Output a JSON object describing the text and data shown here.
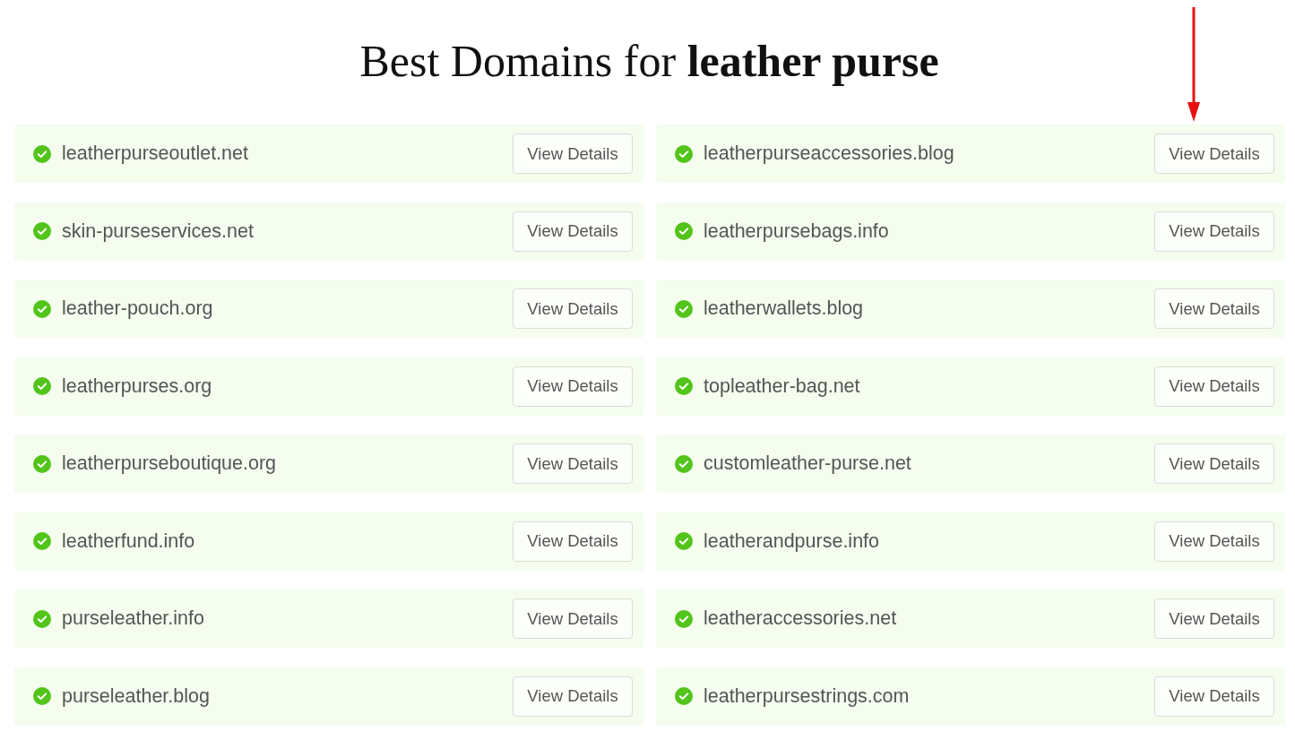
{
  "title": "Best Domains for **leather purse**",
  "domains": [
    {
      "name": "leatherpurseoutlet.net",
      "button": "View Details"
    },
    {
      "name": "leatherpurseaccessories.blog",
      "button": "View Details"
    },
    {
      "name": "skin-purseservices.net",
      "button": "View Details"
    },
    {
      "name": "leatherpursebags.info",
      "button": "View Details"
    },
    {
      "name": "leather-pouch.org",
      "button": "View Details"
    },
    {
      "name": "leatherwallets.blog",
      "button": "View Details"
    },
    {
      "name": "leatherpurses.org",
      "button": "View Details"
    },
    {
      "name": "topleather-bag.net",
      "button": "View Details"
    },
    {
      "name": "leatherpurseboutique.org",
      "button": "View Details"
    },
    {
      "name": "customleather-purse.net",
      "button": "View Details"
    },
    {
      "name": "leatherfund.info",
      "button": "View Details"
    },
    {
      "name": "leatherandpurse.info",
      "button": "View Details"
    },
    {
      "name": "purseleather.info",
      "button": "View Details"
    },
    {
      "name": "leatheraccessories.net",
      "button": "View Details"
    },
    {
      "name": "purseleather.blog",
      "button": "View Details"
    },
    {
      "name": "leatherpursestrings.com",
      "button": "View Details"
    }
  ]
}
